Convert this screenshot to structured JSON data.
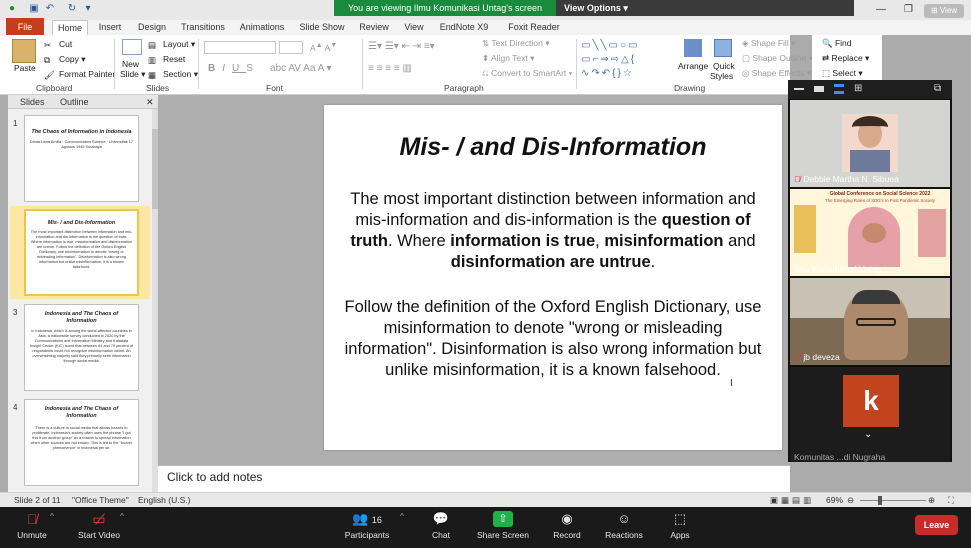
{
  "zoom_banner": {
    "share_message": "You are viewing Ilmu Komunikasi Untag's screen",
    "view_options": "View Options"
  },
  "ribbon_tabs": [
    "File",
    "Home",
    "Insert",
    "Design",
    "Transitions",
    "Animations",
    "Slide Show",
    "Review",
    "View",
    "EndNote X9",
    "Foxit Reader PDF"
  ],
  "clipboard": {
    "paste": "Paste",
    "cut": "Cut",
    "copy": "Copy",
    "format_painter": "Format Painter",
    "label": "Clipboard"
  },
  "slides_group": {
    "new_slide": "New",
    "new_slide_2": "Slide",
    "layout": "Layout",
    "reset": "Reset",
    "section": "Section",
    "label": "Slides"
  },
  "font_group": {
    "label": "Font"
  },
  "paragraph_group": {
    "text_direction": "Text Direction",
    "align_text": "Align Text",
    "convert_smartart": "Convert to SmartArt",
    "label": "Paragraph"
  },
  "drawing_group": {
    "arrange": "Arrange",
    "quick": "Quick",
    "styles": "Styles",
    "shape_fill": "Shape Fill",
    "shape_outline": "Shape Outline",
    "shape_effects": "Shape Effects",
    "label": "Drawing"
  },
  "editing_group": {
    "find": "Find",
    "replace": "Replace",
    "select": "Select"
  },
  "pane": {
    "tab_slides": "Slides",
    "tab_outline": "Outline"
  },
  "thumbnails": [
    {
      "num": "1",
      "title": "The Chaos of Information in Indonesia",
      "body": "Dinda Lisna Amilia · Communication Science · Universitas 17 Agustus 1945 Surabaya"
    },
    {
      "num": "2",
      "title": "Mis- / and Dis-Information",
      "body": "The most important distinction between information and mis-information and dis-information is the question of truth. Where information is true, misinformation and disinformation are untrue. Follow the definition of the Oxford English Dictionary, use misinformation to denote \"wrong or misleading information\". Disinformation is also wrong information but unlike misinformation, it is a known falsehood."
    },
    {
      "num": "3",
      "title": "Indonesia and The Chaos of Information",
      "body": "In Indonesia, which is among the worst-affected countries in Asia, a nationwide survey conducted in 2020 by the Communications and Information Ministry and Katadata Insight Center (KIC) found that between 64 and 79 percent of respondents could not recognize misinformation online. An overwhelming majority said they primarily seek information through social media."
    },
    {
      "num": "4",
      "title": "Indonesia and The Chaos of Information",
      "body": "There is a culture in social media that allows hoaxes to proliferate. Indonesia's society often uses the phrase \"I got this from another group\" as a reason to spread information when other sources are not known. This is led to the \"buzzer phenomenon\" in Indonesia per se."
    }
  ],
  "slide": {
    "title": "Mis- / and Dis-Information",
    "p1_a": "The most important distinction between information and mis-information and dis-information is the ",
    "p1_b": "question of truth",
    "p1_c": ". Where ",
    "p1_d": "information is true",
    "p1_e": ", ",
    "p1_f": "misinformation",
    "p1_g": " and ",
    "p1_h": "disinformation are untrue",
    "p1_i": ".",
    "p2": "Follow the definition of the Oxford English Dictionary, use misinformation to denote \"wrong or misleading information\". Disinformation is also wrong information but unlike misinformation, it is a known falsehood."
  },
  "notes_placeholder": "Click to add notes",
  "status": {
    "slide_count": "Slide 2 of 11",
    "theme": "\"Office Theme\"",
    "language": "English (U.S.)",
    "zoom": "69%"
  },
  "participants_gallery": [
    {
      "name": "Debbie Martha N. Sibuea"
    },
    {
      "name": "Ilmu Komunikasi Untag"
    },
    {
      "name": "jb deveza"
    },
    {
      "name": "Komunitas ...di Nugraha",
      "avatar_letter": "k"
    }
  ],
  "conference_poster": {
    "title": "Global Conference on Social Science 2022",
    "subtitle": "The Emerging Roles of SDG's In Post Pandemic Society"
  },
  "zoom_toolbar": {
    "unmute": "Unmute",
    "start_video": "Start Video",
    "participants": "Participants",
    "participants_count": "16",
    "chat": "Chat",
    "share_screen": "Share Screen",
    "record": "Record",
    "reactions": "Reactions",
    "apps": "Apps",
    "leave": "Leave"
  },
  "colors": {
    "share_green": "#1a8a3d",
    "file_tab": "#c43e1c",
    "leave_red": "#c92a2a",
    "avatar_orange": "#c1441f"
  }
}
